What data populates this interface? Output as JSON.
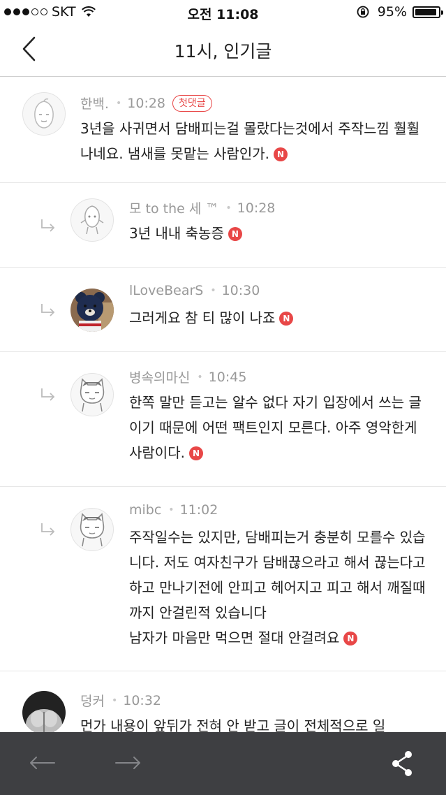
{
  "status_bar": {
    "carrier": "SKT",
    "time": "오전 11:08",
    "battery_text": "95%",
    "battery_level": 0.95
  },
  "nav": {
    "title": "11시, 인기글"
  },
  "comments": [
    {
      "author": "한백.",
      "time": "10:28",
      "badge": "첫댓글",
      "text": "3년을 사귀면서 담배피는걸 몰랐다는것에서 주작느낌 훨훨나네요. 냄새를 못맡는 사람인가.",
      "n_badge": "N",
      "reply": false,
      "avatar_icon": "peach-character-icon"
    },
    {
      "author": "모 to the 세 ™",
      "time": "10:28",
      "text": "3년 내내 축농증",
      "n_badge": "N",
      "reply": true,
      "avatar_icon": "peach-character-icon"
    },
    {
      "author": "lLoveBearS",
      "time": "10:30",
      "text": "그러게요 참 티 많이 나죠",
      "n_badge": "N",
      "reply": true,
      "avatar_icon": "bear-photo-icon"
    },
    {
      "author": "병속의마신",
      "time": "10:45",
      "text": "한쪽 말만 듣고는 알수 없다 자기 입장에서 쓰는 글이기 때문에 어떤 팩트인지 모른다. 아주 영악한게 사람이다.",
      "n_badge": "N",
      "reply": true,
      "avatar_icon": "cat-character-icon"
    },
    {
      "author": "mibc",
      "time": "11:02",
      "text": "주작일수는 있지만, 담배피는거 충분히 모를수 있습니다. 저도 여자친구가 담배끊으라고 해서 끊는다고하고 만나기전에 안피고 헤어지고 피고 해서 깨질때까지 안걸린적 있습니다\n남자가 마음만 먹으면 절대 안걸려요",
      "n_badge": "N",
      "reply": true,
      "avatar_icon": "cat-character-icon"
    },
    {
      "author": "덩커",
      "time": "10:32",
      "text": "먼가 내용이 앞뒤가 전혀 안 받고 글이 전체적으로 일",
      "reply": false,
      "avatar_icon": "photo-avatar-icon"
    }
  ],
  "colors": {
    "accent_red": "#e84747",
    "toolbar_bg": "#3e3f42",
    "meta_gray": "#999999"
  },
  "toolbar": {
    "back_icon": "arrow-left-icon",
    "forward_icon": "arrow-right-icon",
    "share_icon": "share-icon"
  }
}
